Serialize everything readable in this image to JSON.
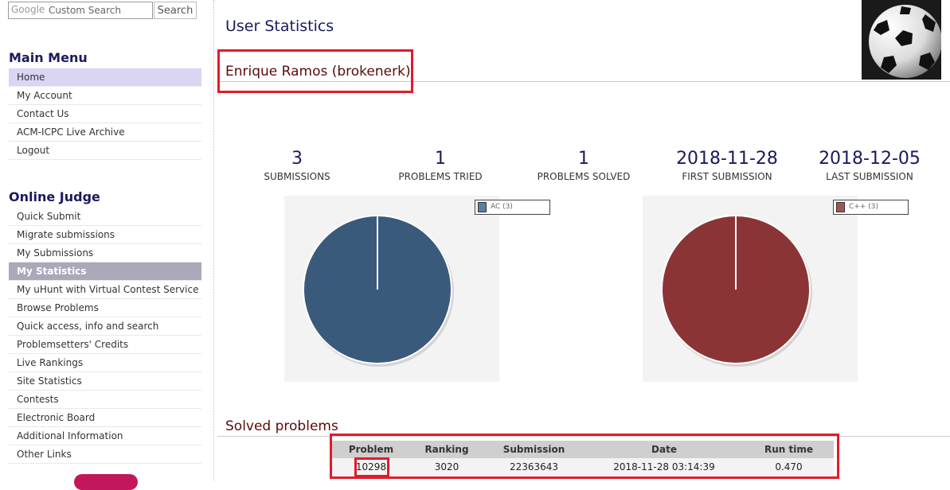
{
  "search": {
    "placeholder": "Custom Search",
    "brand": "Google",
    "button": "Search"
  },
  "main_menu": {
    "title": "Main Menu",
    "items": [
      "Home",
      "My Account",
      "Contact Us",
      "ACM-ICPC Live Archive",
      "Logout"
    ]
  },
  "online_judge": {
    "title": "Online Judge",
    "items": [
      "Quick Submit",
      "Migrate submissions",
      "My Submissions",
      "My Statistics",
      "My uHunt with Virtual Contest Service",
      "Browse Problems",
      "Quick access, info and search",
      "Problemsetters' Credits",
      "Live Rankings",
      "Site Statistics",
      "Contests",
      "Electronic Board",
      "Additional Information",
      "Other Links"
    ]
  },
  "page": {
    "title": "User Statistics",
    "user": "Enrique Ramos (brokenerk)"
  },
  "stats": [
    {
      "value": "3",
      "label": "SUBMISSIONS"
    },
    {
      "value": "1",
      "label": "PROBLEMS TRIED"
    },
    {
      "value": "1",
      "label": "PROBLEMS SOLVED"
    },
    {
      "value": "2018-11-28",
      "label": "FIRST SUBMISSION"
    },
    {
      "value": "2018-12-05",
      "label": "LAST SUBMISSION"
    }
  ],
  "chart_data": [
    {
      "type": "pie",
      "categories": [
        "AC (3)"
      ],
      "values": [
        3
      ],
      "colors": [
        "#3a5a7c"
      ],
      "legend": "top-right"
    },
    {
      "type": "pie",
      "categories": [
        "C++ (3)"
      ],
      "values": [
        3
      ],
      "colors": [
        "#8b3436"
      ],
      "legend": "top-right"
    }
  ],
  "solved": {
    "title": "Solved problems",
    "columns": [
      "Problem",
      "Ranking",
      "Submission",
      "Date",
      "Run time"
    ],
    "rows": [
      [
        "10298",
        "3020",
        "22363643",
        "2018-11-28 03:14:39",
        "0.470"
      ]
    ]
  },
  "colors": {
    "accent": "#1a1a5e",
    "highlight": "#e21b2a"
  }
}
